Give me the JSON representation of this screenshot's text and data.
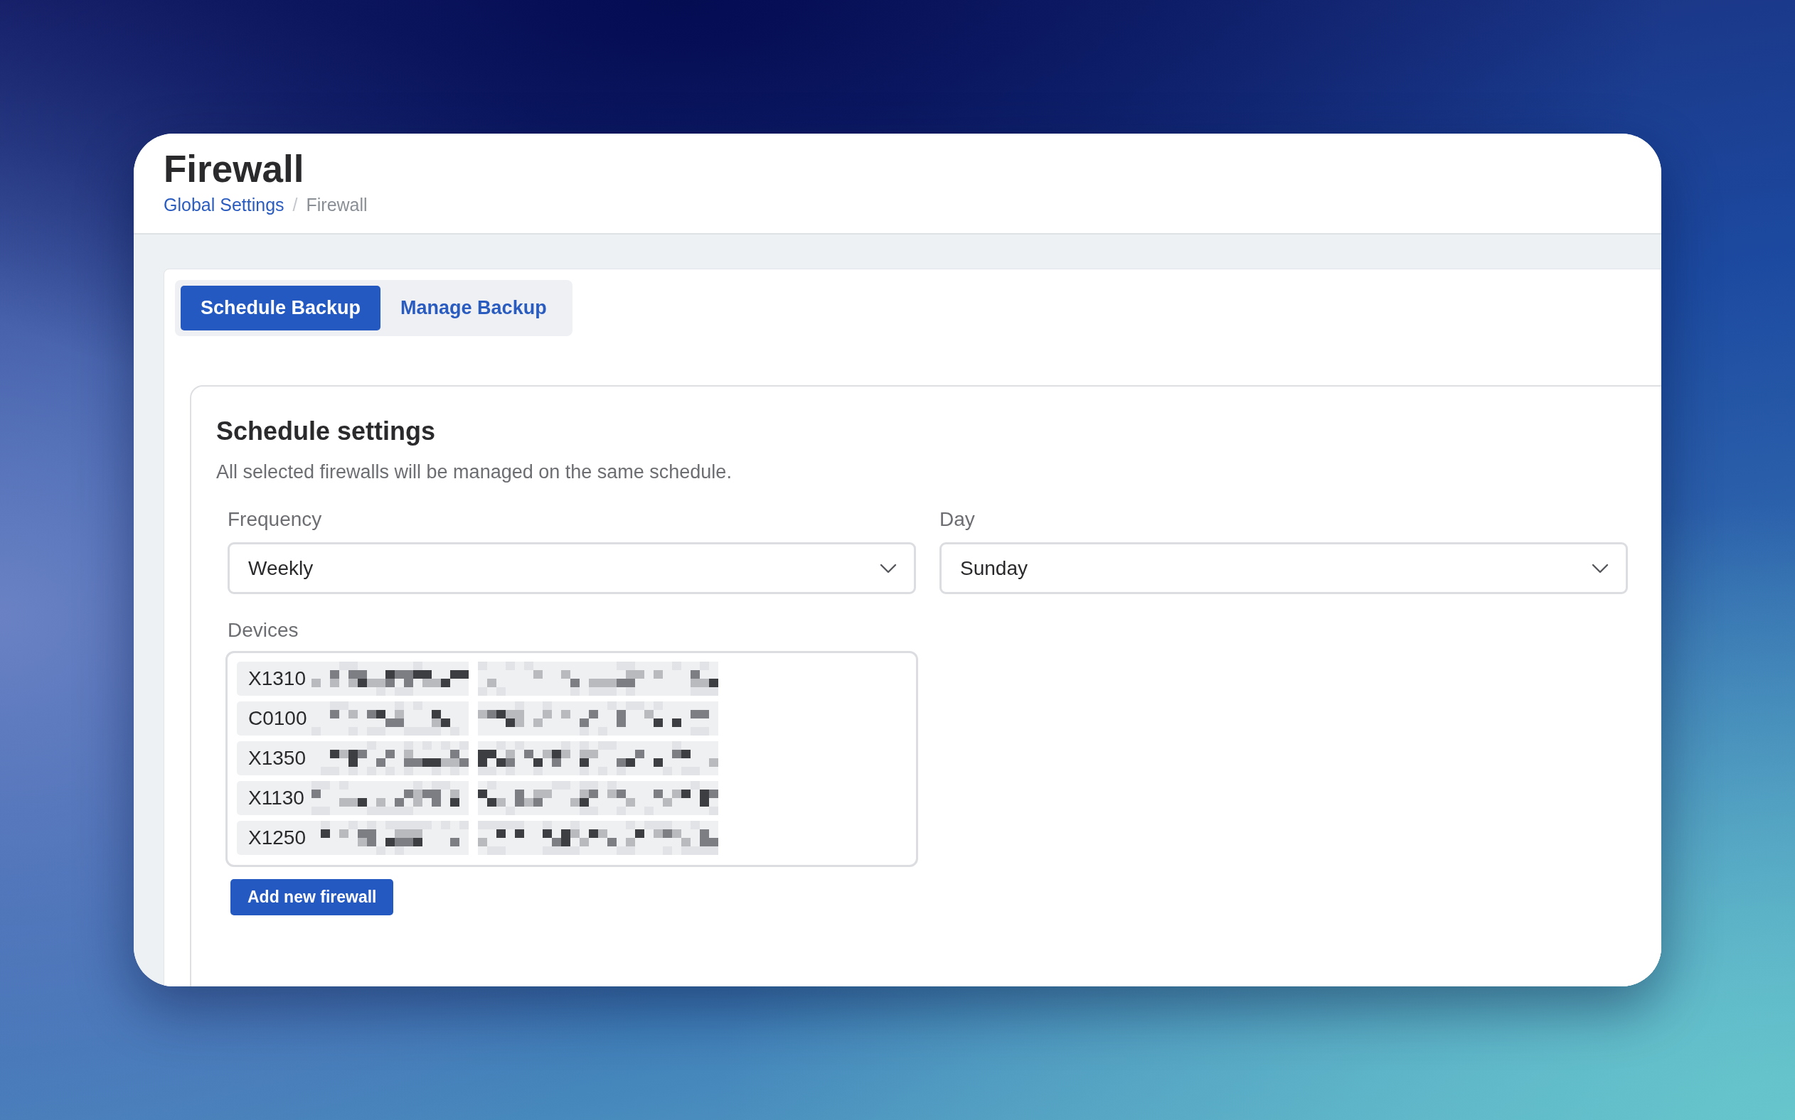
{
  "page": {
    "title": "Firewall",
    "breadcrumb": {
      "separator": "/",
      "items": [
        {
          "label": "Global Settings",
          "current": false
        },
        {
          "label": "Firewall",
          "current": true
        }
      ]
    }
  },
  "tabs": [
    {
      "label": "Schedule Backup",
      "selected": true
    },
    {
      "label": "Manage Backup",
      "selected": false
    }
  ],
  "schedule_settings": {
    "title": "Schedule settings",
    "description": "All selected firewalls will be managed on the same schedule.",
    "fields": [
      {
        "label": "Frequency",
        "value": "Weekly"
      },
      {
        "label": "Day",
        "value": "Sunday"
      }
    ],
    "devices": {
      "label": "Devices",
      "items": [
        {
          "text": "X1310",
          "redacted": true
        },
        {
          "text": "C0100",
          "redacted": true
        },
        {
          "text": "X1350",
          "redacted": true
        },
        {
          "text": "X1130",
          "redacted": true
        },
        {
          "text": "X1250",
          "redacted": true
        }
      ]
    },
    "add_button": "Add new firewall"
  }
}
